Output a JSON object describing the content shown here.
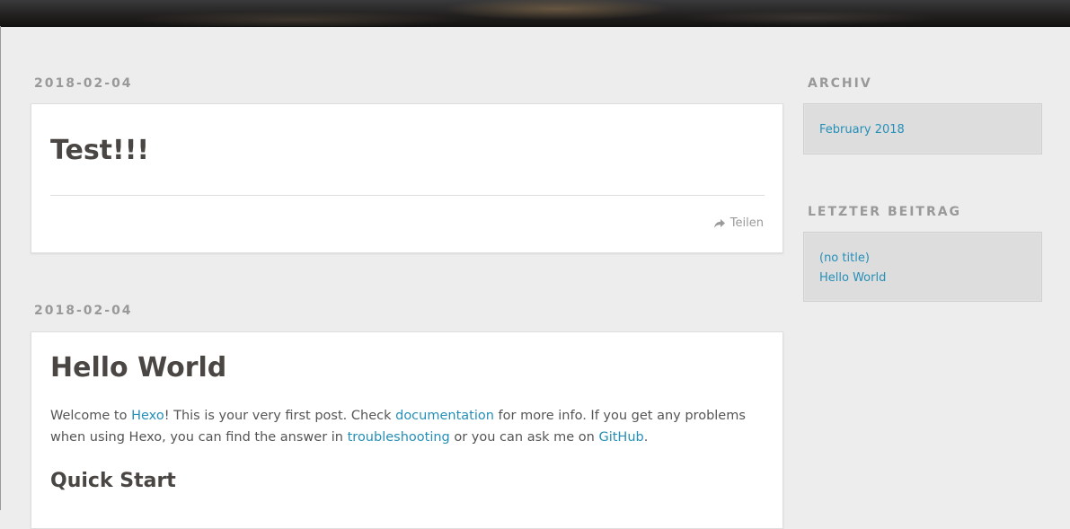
{
  "posts": [
    {
      "date": "2018-02-04",
      "title": "Test!!!",
      "share_label": "Teilen"
    },
    {
      "date": "2018-02-04",
      "title": "Hello World",
      "intro": {
        "t1": "Welcome to ",
        "link_hexo": "Hexo",
        "t2": "! This is your very first post. Check ",
        "link_docs": "documentation",
        "t3": " for more info. If you get any problems when using Hexo, you can find the answer in ",
        "link_troubleshooting": "troubleshooting",
        "t4": " or you can ask me on ",
        "link_github": "GitHub",
        "t5": "."
      },
      "subheading": "Quick Start"
    }
  ],
  "sidebar": {
    "archive": {
      "title": "ARCHIV",
      "items": [
        "February 2018"
      ]
    },
    "recent": {
      "title": "LETZTER BEITRAG",
      "items": [
        "(no title)",
        "Hello World"
      ]
    }
  },
  "colors": {
    "background": "#ededed",
    "link": "#258fb8",
    "heading": "#4a4644",
    "muted": "#999999",
    "widget_bg": "#dddddd"
  },
  "icons": {
    "share": "share-arrow-icon"
  }
}
